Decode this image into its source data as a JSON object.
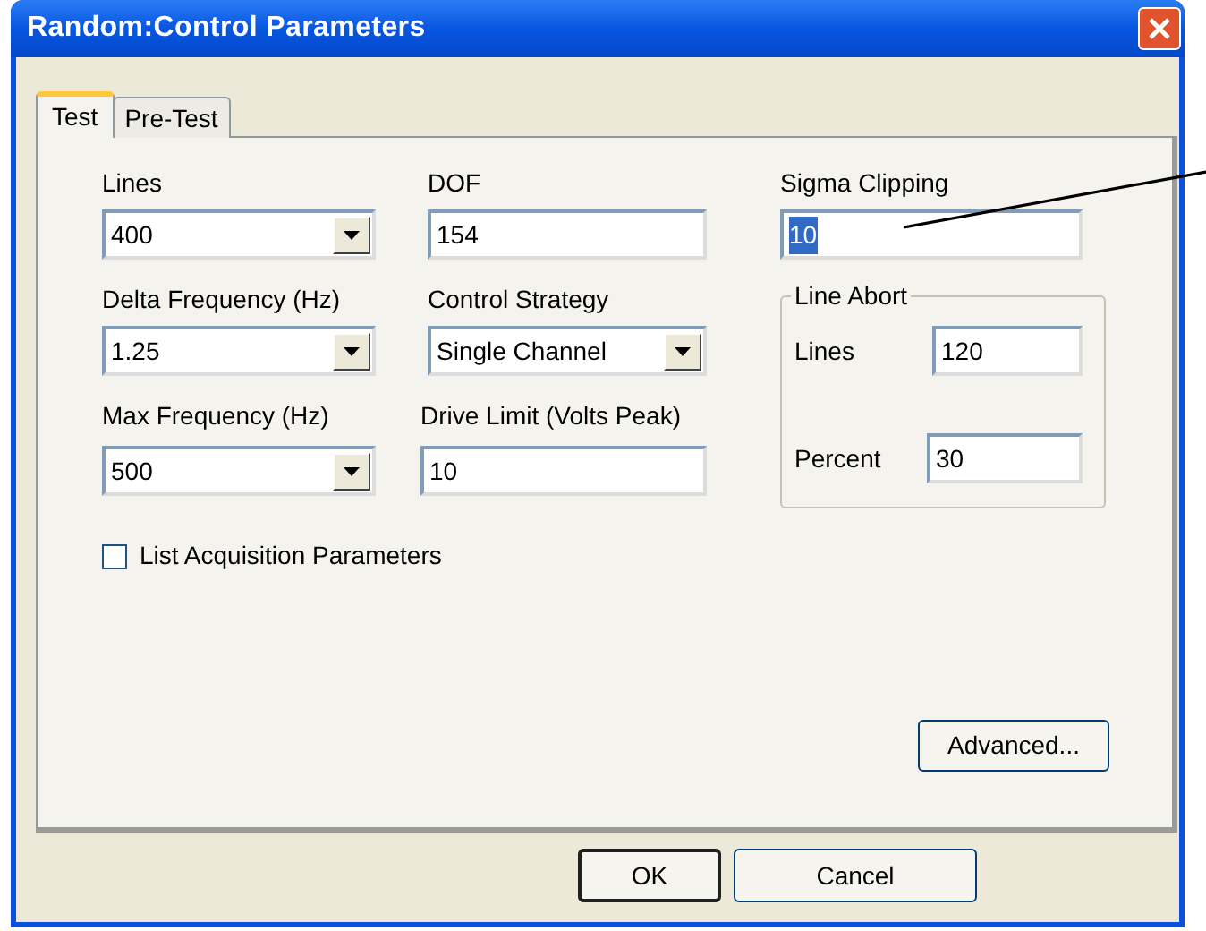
{
  "window": {
    "title": "Random:Control Parameters"
  },
  "tabs": [
    {
      "label": "Test",
      "selected": true
    },
    {
      "label": "Pre-Test",
      "selected": false
    }
  ],
  "columns": [
    [
      {
        "kind": "combo",
        "label": "Lines",
        "value": "400"
      },
      {
        "kind": "combo",
        "label": "Delta Frequency  (Hz)",
        "value": "1.25"
      },
      {
        "kind": "combo",
        "label": "Max Frequency (Hz)",
        "value": "500"
      }
    ],
    [
      {
        "kind": "text",
        "label": "DOF",
        "value": "154"
      },
      {
        "kind": "combo",
        "label": "Control Strategy",
        "value": "Single Channel"
      },
      {
        "kind": "text",
        "label": "Drive Limit (Volts Peak)",
        "value": "10"
      }
    ]
  ],
  "sigma_clipping": {
    "label": "Sigma Clipping",
    "value": "10",
    "text_selected": true
  },
  "line_abort": {
    "title": "Line Abort",
    "fields": [
      {
        "label": "Lines",
        "value": "120"
      },
      {
        "label": "Percent",
        "value": "30"
      }
    ]
  },
  "checkbox": {
    "label": "List Acquisition Parameters",
    "checked": false
  },
  "advanced_button": "Advanced...",
  "buttons": [
    {
      "label": "OK",
      "default": true
    },
    {
      "label": "Cancel",
      "default": false
    }
  ]
}
